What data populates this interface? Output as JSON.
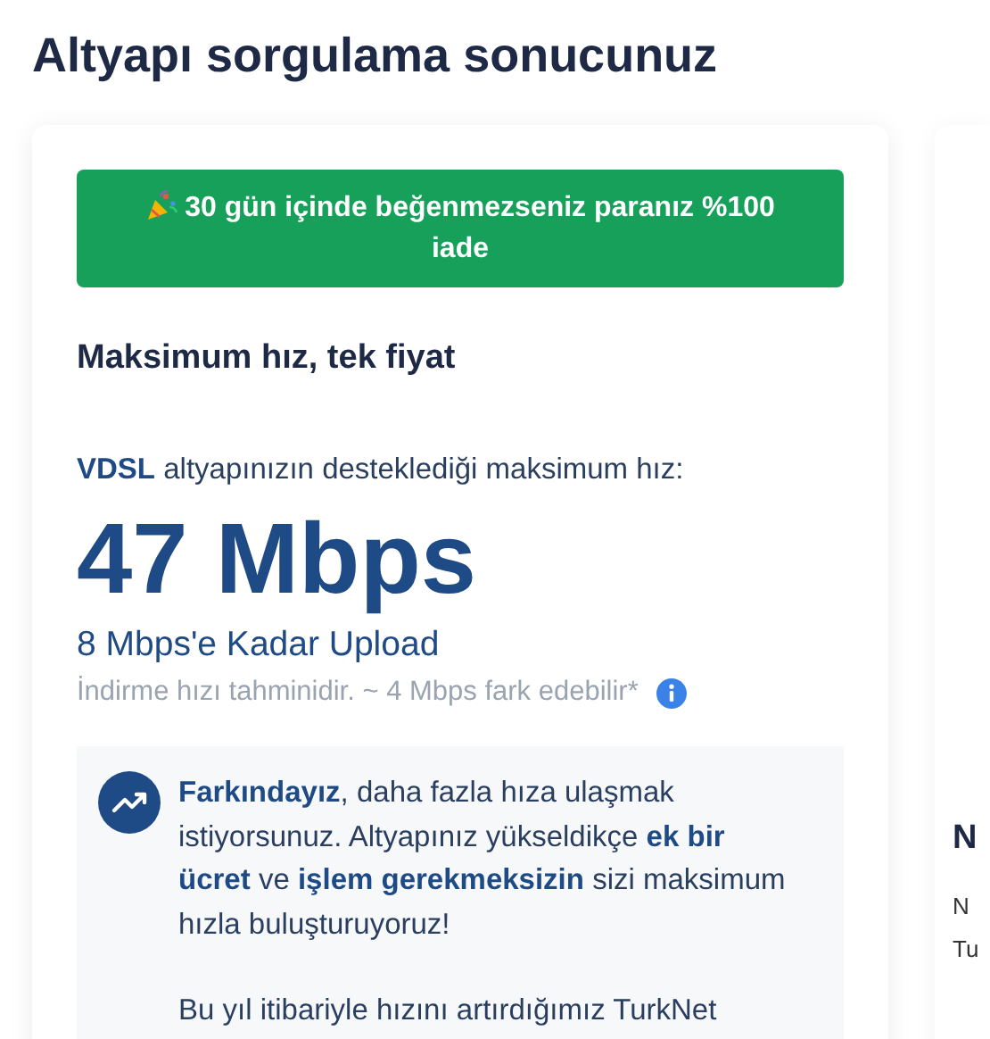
{
  "title": "Altyapı sorgulama sonucunuz",
  "banner": {
    "text": "30 gün içinde beğenmezseniz paranız %100 iade"
  },
  "heading": "Maksimum hız, tek fiyat",
  "support_text": "**VDSL** altyapınızın desteklediği maksimum hız:",
  "speed": "47 Mbps",
  "upload": "8 Mbps'e Kadar Upload",
  "note": "İndirme hızı tahminidir. ~ 4 Mbps fark edebilir*",
  "notice": {
    "paragraphs": [
      "**Farkındayız**, daha fazla hıza ulaşmak istiyorsunuz. Altyapınız yükseldikçe **ek bir ücret** ve **işlem gerekmeksizin** sizi maksimum hızla buluşturuyoruz!",
      "Bu yıl itibariyle hızını artırdığımız TurkNet"
    ]
  },
  "side_card": {
    "heading": "N",
    "lines": [
      "N",
      "Tu"
    ]
  }
}
